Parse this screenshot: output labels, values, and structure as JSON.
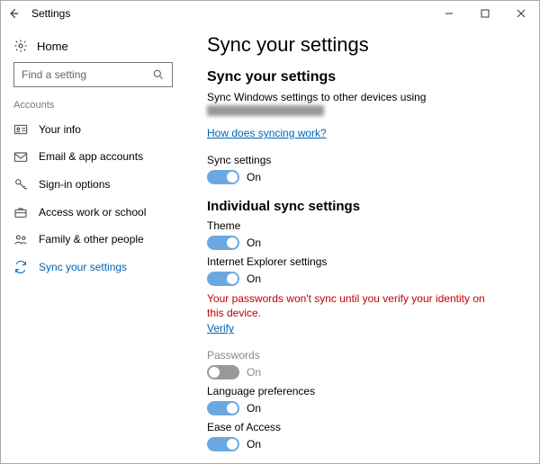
{
  "titlebar": {
    "title": "Settings"
  },
  "sidebar": {
    "home": "Home",
    "search_placeholder": "Find a setting",
    "section": "Accounts",
    "items": [
      {
        "label": "Your info"
      },
      {
        "label": "Email & app accounts"
      },
      {
        "label": "Sign-in options"
      },
      {
        "label": "Access work or school"
      },
      {
        "label": "Family & other people"
      },
      {
        "label": "Sync your settings"
      }
    ]
  },
  "content": {
    "page_title": "Sync your settings",
    "section1_title": "Sync your settings",
    "desc": "Sync Windows settings to other devices using",
    "help_link": "How does syncing work?",
    "section2_title": "Individual sync settings",
    "warning": "Your passwords won't sync until you verify your identity on this device.",
    "verify_link": "Verify",
    "toggles": {
      "sync_settings": {
        "label": "Sync settings",
        "state": "On",
        "on": true,
        "disabled": false
      },
      "theme": {
        "label": "Theme",
        "state": "On",
        "on": true,
        "disabled": false
      },
      "ie": {
        "label": "Internet Explorer settings",
        "state": "On",
        "on": true,
        "disabled": false
      },
      "passwords": {
        "label": "Passwords",
        "state": "On",
        "on": false,
        "disabled": true
      },
      "language": {
        "label": "Language preferences",
        "state": "On",
        "on": true,
        "disabled": false
      },
      "ease": {
        "label": "Ease of Access",
        "state": "On",
        "on": true,
        "disabled": false
      }
    }
  }
}
